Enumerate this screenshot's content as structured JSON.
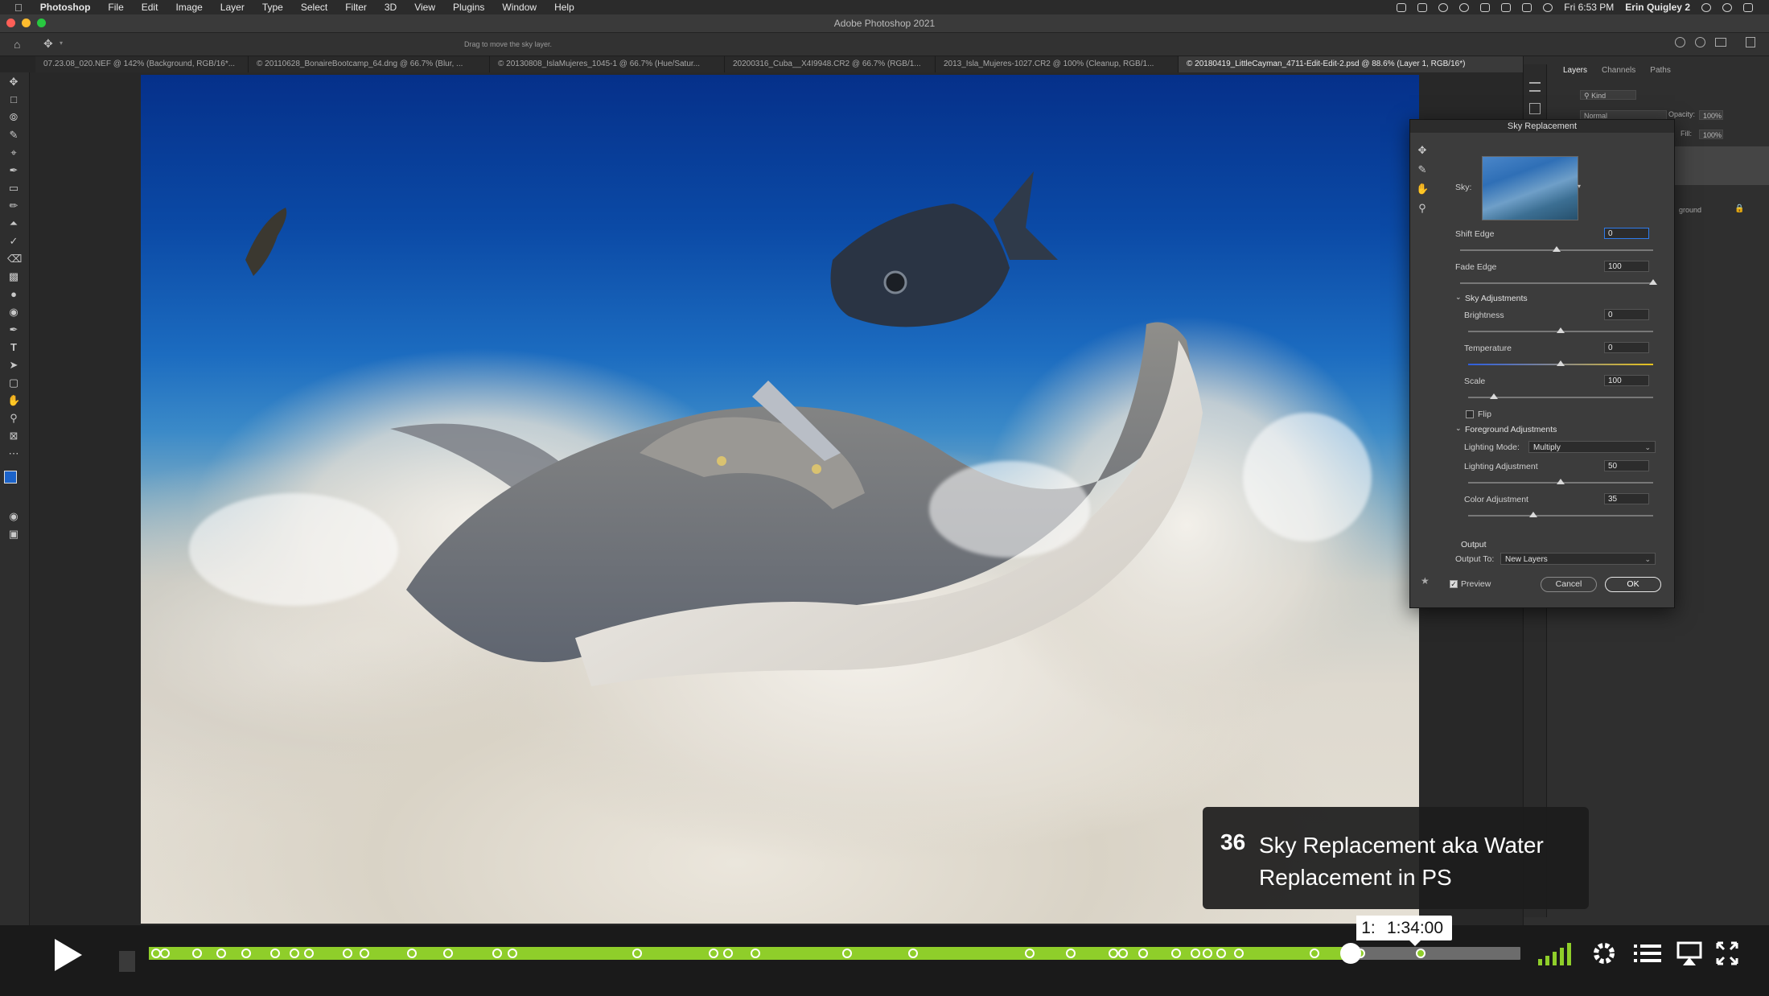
{
  "menubar": {
    "app_name": "Photoshop",
    "menus": [
      "File",
      "Edit",
      "Image",
      "Layer",
      "Type",
      "Select",
      "Filter",
      "3D",
      "View",
      "Plugins",
      "Window",
      "Help"
    ],
    "clock": "Fri 6:53 PM",
    "user": "Erin Quigley 2"
  },
  "window": {
    "title": "Adobe Photoshop 2021",
    "options_hint": "Drag to move the sky layer."
  },
  "tabs": [
    {
      "label": "07.23.08_020.NEF @ 142% (Background, RGB/16*...",
      "active": false
    },
    {
      "label": "© 20110628_BonaireBootcamp_64.dng @ 66.7% (Blur, ...",
      "active": false
    },
    {
      "label": "© 20130808_IslaMujeres_1045-1 @ 66.7% (Hue/Satur...",
      "active": false
    },
    {
      "label": "20200316_Cuba__X4I9948.CR2 @ 66.7% (RGB/1...",
      "active": false
    },
    {
      "label": "2013_Isla_Mujeres-1027.CR2 @ 100% (Cleanup, RGB/1...",
      "active": false
    },
    {
      "label": "© 20180419_LittleCayman_4711-Edit-Edit-2.psd @ 88.6% (Layer 1, RGB/16*)",
      "active": true
    }
  ],
  "layers_panel": {
    "tabs": [
      "Layers",
      "Channels",
      "Paths"
    ],
    "active_tab": "Layers",
    "filter": "Kind",
    "blend_mode": "Normal",
    "opacity_label": "Opacity:",
    "opacity": "100%",
    "fill_label": "Fill:",
    "fill": "100%",
    "layer_name_partial": "ground"
  },
  "dialog": {
    "title": "Sky Replacement",
    "sky_label": "Sky:",
    "shift_edge": {
      "label": "Shift Edge",
      "value": "0",
      "level": 0.5
    },
    "fade_edge": {
      "label": "Fade Edge",
      "value": "100",
      "level": 1.0
    },
    "sky_adjustments_header": "Sky Adjustments",
    "brightness": {
      "label": "Brightness",
      "value": "0",
      "level": 0.5
    },
    "temperature": {
      "label": "Temperature",
      "value": "0",
      "level": 0.5
    },
    "scale": {
      "label": "Scale",
      "value": "100",
      "level": 0.14
    },
    "flip_label": "Flip",
    "flip_checked": false,
    "foreground_adjustments_header": "Foreground Adjustments",
    "lighting_mode_label": "Lighting Mode:",
    "lighting_mode_value": "Multiply",
    "lighting_adjustment": {
      "label": "Lighting Adjustment",
      "value": "50",
      "level": 0.5
    },
    "color_adjustment": {
      "label": "Color Adjustment",
      "value": "35",
      "level": 0.35
    },
    "output_header": "Output",
    "output_to_label": "Output To:",
    "output_to_value": "New Layers",
    "preview_label": "Preview",
    "preview_checked": true,
    "cancel_label": "Cancel",
    "ok_label": "OK"
  },
  "chapter_card": {
    "number": "36",
    "title": "Sky Replacement aka Water Replacement in PS"
  },
  "player": {
    "hover_time_prefix": "1:",
    "hover_time": "1:34:00",
    "progress": 0.876,
    "chapter_markers": [
      0.005,
      0.012,
      0.035,
      0.053,
      0.071,
      0.092,
      0.106,
      0.117,
      0.145,
      0.157,
      0.192,
      0.218,
      0.254,
      0.265,
      0.356,
      0.412,
      0.422,
      0.442,
      0.509,
      0.557,
      0.642,
      0.672,
      0.703,
      0.71,
      0.725,
      0.749,
      0.763,
      0.772,
      0.782,
      0.795,
      0.85,
      0.875,
      0.883,
      0.927
    ],
    "accent_color": "#8fce2a"
  }
}
